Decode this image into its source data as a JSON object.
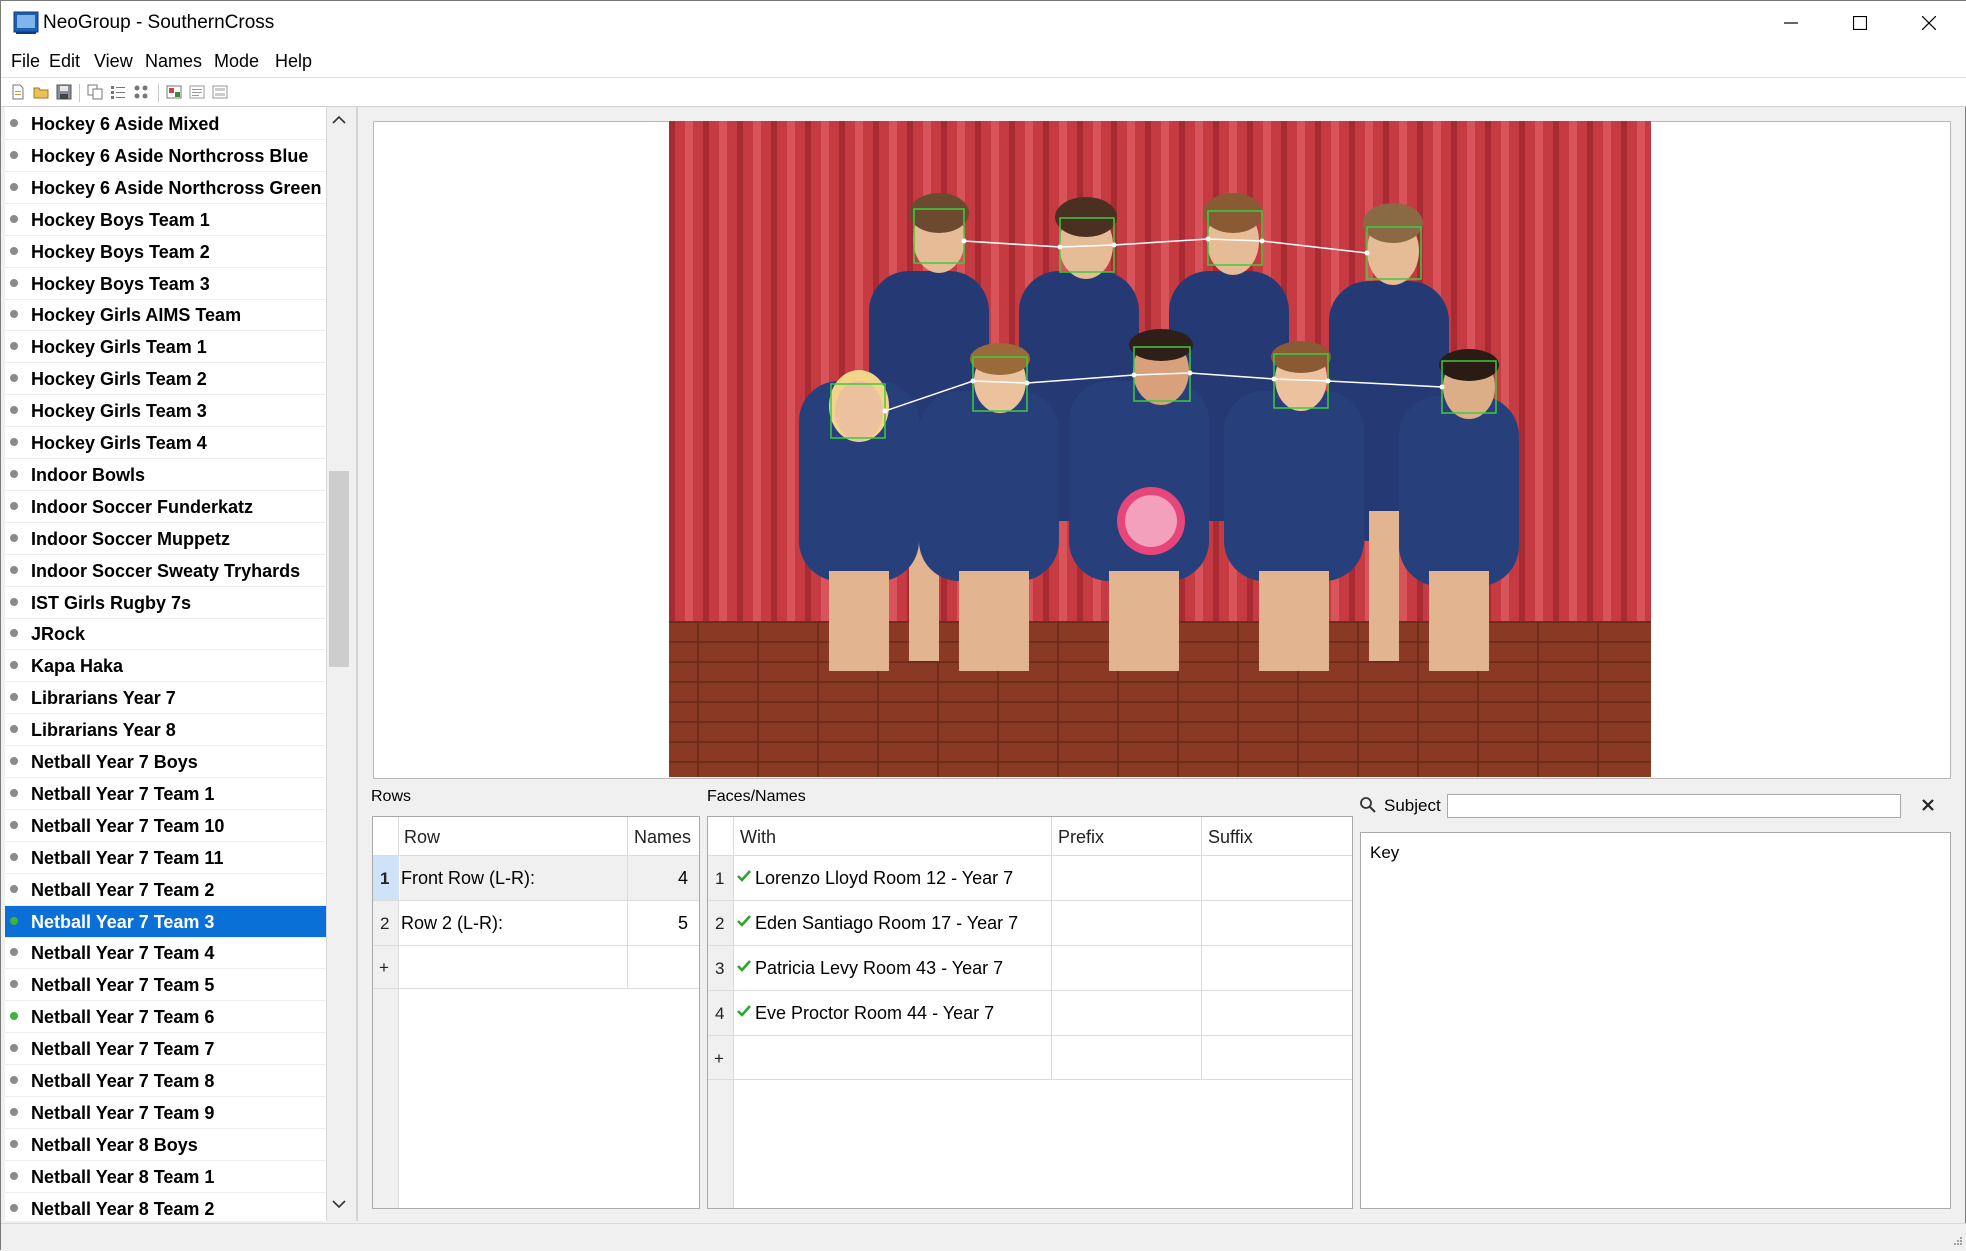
{
  "window": {
    "title": "NeoGroup - SouthernCross"
  },
  "menu": [
    "File",
    "Edit",
    "View",
    "Names",
    "Mode",
    "Help"
  ],
  "groups": [
    {
      "label": "Hockey 6 Aside Mixed",
      "dot": "gray"
    },
    {
      "label": "Hockey 6 Aside Northcross Blue",
      "dot": "gray"
    },
    {
      "label": "Hockey 6 Aside Northcross Green",
      "dot": "gray"
    },
    {
      "label": "Hockey Boys Team 1",
      "dot": "gray"
    },
    {
      "label": "Hockey Boys Team 2",
      "dot": "gray"
    },
    {
      "label": "Hockey Boys Team 3",
      "dot": "gray"
    },
    {
      "label": "Hockey Girls AIMS Team",
      "dot": "gray"
    },
    {
      "label": "Hockey Girls Team 1",
      "dot": "gray"
    },
    {
      "label": "Hockey Girls Team 2",
      "dot": "gray"
    },
    {
      "label": "Hockey Girls Team 3",
      "dot": "gray"
    },
    {
      "label": "Hockey Girls Team 4",
      "dot": "gray"
    },
    {
      "label": "Indoor Bowls",
      "dot": "gray"
    },
    {
      "label": "Indoor Soccer Funderkatz",
      "dot": "gray"
    },
    {
      "label": "Indoor Soccer Muppetz",
      "dot": "gray"
    },
    {
      "label": "Indoor Soccer Sweaty Tryhards",
      "dot": "gray"
    },
    {
      "label": "IST Girls Rugby 7s",
      "dot": "gray"
    },
    {
      "label": "JRock",
      "dot": "gray"
    },
    {
      "label": "Kapa Haka",
      "dot": "gray"
    },
    {
      "label": "Librarians Year 7",
      "dot": "gray"
    },
    {
      "label": "Librarians Year 8",
      "dot": "gray"
    },
    {
      "label": "Netball Year 7 Boys",
      "dot": "gray"
    },
    {
      "label": "Netball Year 7 Team 1",
      "dot": "gray"
    },
    {
      "label": "Netball Year 7 Team 10",
      "dot": "gray"
    },
    {
      "label": "Netball Year 7 Team 11",
      "dot": "gray"
    },
    {
      "label": "Netball Year 7 Team 2",
      "dot": "gray"
    },
    {
      "label": "Netball Year 7 Team 3",
      "dot": "green",
      "selected": true
    },
    {
      "label": "Netball Year 7 Team 4",
      "dot": "gray"
    },
    {
      "label": "Netball Year 7 Team 5",
      "dot": "gray"
    },
    {
      "label": "Netball Year 7 Team 6",
      "dot": "green"
    },
    {
      "label": "Netball Year 7 Team 7",
      "dot": "gray"
    },
    {
      "label": "Netball Year 7 Team 8",
      "dot": "gray"
    },
    {
      "label": "Netball Year 7 Team 9",
      "dot": "gray"
    },
    {
      "label": "Netball Year 8 Boys",
      "dot": "gray"
    },
    {
      "label": "Netball Year 8 Team 1",
      "dot": "gray"
    },
    {
      "label": "Netball Year 8 Team 2",
      "dot": "gray"
    }
  ],
  "rows_panel": {
    "label": "Rows",
    "col_row": "Row",
    "col_names": "Names",
    "rows": [
      {
        "num": "1",
        "row": "Front Row (L-R):",
        "names": "4"
      },
      {
        "num": "2",
        "row": "Row 2 (L-R):",
        "names": "5"
      }
    ],
    "add": "+"
  },
  "faces_panel": {
    "label": "Faces/Names",
    "col_with": "With",
    "col_prefix": "Prefix",
    "col_suffix": "Suffix",
    "rows": [
      {
        "num": "1",
        "with": "Lorenzo Lloyd Room 12 - Year 7"
      },
      {
        "num": "2",
        "with": "Eden Santiago Room 17 - Year 7"
      },
      {
        "num": "3",
        "with": "Patricia Levy Room 43 - Year 7"
      },
      {
        "num": "4",
        "with": "Eve Proctor Room 44 - Year 7"
      }
    ],
    "add": "+"
  },
  "subject": {
    "label": "Subject",
    "value": ""
  },
  "key_panel": {
    "label": "Key"
  },
  "colors": {
    "selection": "#0a6fd6",
    "check": "#2fa52f",
    "face_box": "#3dcc3d",
    "curtain": "#c8343a"
  }
}
